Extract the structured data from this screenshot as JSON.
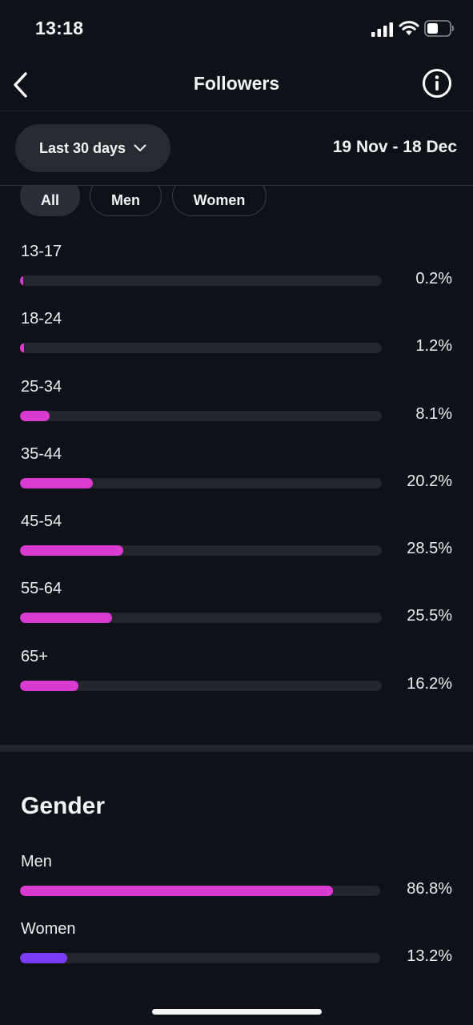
{
  "status_bar": {
    "time": "13:18",
    "icons": [
      "signal-icon",
      "wifi-icon",
      "battery-icon"
    ]
  },
  "header": {
    "title": "Followers",
    "back_icon": "chevron-left-icon",
    "info_icon": "info-icon"
  },
  "date_filter": {
    "selected_range": "Last 30 days",
    "date_range": "19 Nov - 18 Dec"
  },
  "chips": [
    {
      "label": "All",
      "active": true
    },
    {
      "label": "Men",
      "active": false
    },
    {
      "label": "Women",
      "active": false
    }
  ],
  "age_ranges": [
    {
      "label": "13-17",
      "value": "0.2%",
      "percent": 0.2
    },
    {
      "label": "18-24",
      "value": "1.2%",
      "percent": 1.2
    },
    {
      "label": "25-34",
      "value": "8.1%",
      "percent": 8.1
    },
    {
      "label": "35-44",
      "value": "20.2%",
      "percent": 20.2
    },
    {
      "label": "45-54",
      "value": "28.5%",
      "percent": 28.5
    },
    {
      "label": "55-64",
      "value": "25.5%",
      "percent": 25.5
    },
    {
      "label": "65+",
      "value": "16.2%",
      "percent": 16.2
    }
  ],
  "gender": {
    "title": "Gender",
    "items": [
      {
        "label": "Men",
        "value": "86.8%",
        "percent": 86.8,
        "color": "#d93bd0"
      },
      {
        "label": "Women",
        "value": "13.2%",
        "percent": 13.2,
        "color": "#7a3cf5"
      }
    ]
  },
  "colors": {
    "background": "#0e1117",
    "accent_pink": "#d93bd0",
    "accent_purple": "#7a3cf5",
    "bar_track": "#23262d"
  }
}
